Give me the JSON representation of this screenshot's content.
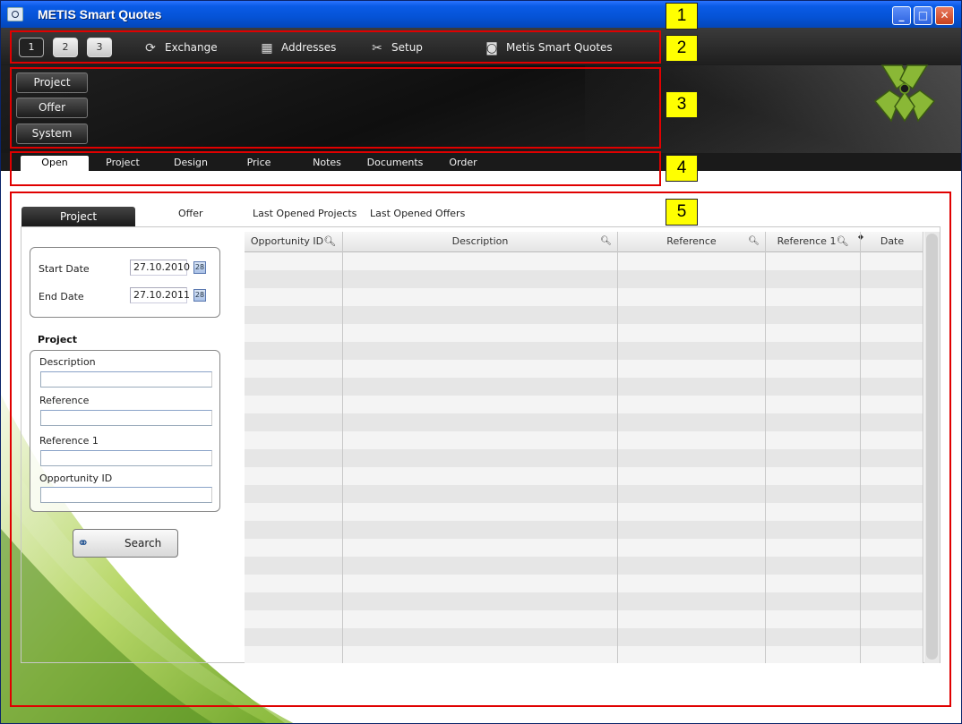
{
  "window": {
    "title": "METIS Smart Quotes",
    "controls": [
      "_",
      "□",
      "✕"
    ]
  },
  "toolbar": {
    "pages": [
      "1",
      "2",
      "3"
    ],
    "items": [
      {
        "label": "Exchange",
        "icon": "exchange-icon"
      },
      {
        "label": "Addresses",
        "icon": "addresses-icon"
      },
      {
        "label": "Setup",
        "icon": "setup-icon"
      },
      {
        "label": "Metis Smart Quotes",
        "icon": "metis-icon"
      }
    ]
  },
  "header": {
    "buttons": [
      "Project",
      "Offer",
      "System"
    ]
  },
  "tabs": [
    "Open",
    "Project",
    "Design",
    "Price",
    "Notes",
    "Documents",
    "Order"
  ],
  "panel": {
    "tabs": [
      "Project",
      "Offer",
      "Last Opened Projects",
      "Last Opened Offers"
    ],
    "dates": {
      "start_label": "Start Date",
      "start_value": "27.10.2010",
      "end_label": "End Date",
      "end_value": "27.10.2011"
    },
    "section_title": "Project",
    "fields": [
      "Description",
      "Reference",
      "Reference 1",
      "Opportunity ID"
    ],
    "search_label": "Search"
  },
  "grid": {
    "columns": [
      "Opportunity ID",
      "Description",
      "Reference",
      "Reference 1",
      "Date"
    ]
  },
  "annotations": [
    "1",
    "2",
    "3",
    "4",
    "5"
  ],
  "colors": {
    "annotation": "#e00000",
    "annotation_label_bg": "#ffff00",
    "titlebar": "#0553d6"
  }
}
